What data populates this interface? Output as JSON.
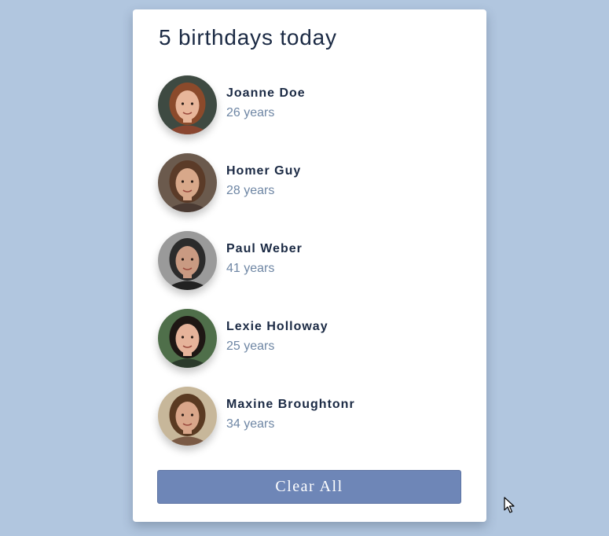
{
  "header": {
    "title": "5 birthdays today"
  },
  "people": [
    {
      "name": "Joanne Doe",
      "age": "26 years",
      "avatar_icon": "portrait-woman-red-hair",
      "colors": {
        "bg": "#3e4a42",
        "hair": "#8b4a2b",
        "skin": "#e8b69a",
        "shirt": "#8a4630"
      }
    },
    {
      "name": "Homer Guy",
      "age": "28 years",
      "avatar_icon": "portrait-young-man",
      "colors": {
        "bg": "#6b5a4d",
        "hair": "#5b3b28",
        "skin": "#d8a88a",
        "shirt": "#4a3a33"
      }
    },
    {
      "name": "Paul Weber",
      "age": "41 years",
      "avatar_icon": "portrait-man-glasses",
      "colors": {
        "bg": "#9a9a9a",
        "hair": "#2b2b2b",
        "skin": "#c99a82",
        "shirt": "#222222"
      }
    },
    {
      "name": "Lexie Holloway",
      "age": "25 years",
      "avatar_icon": "portrait-woman-dark-hair",
      "colors": {
        "bg": "#4f6f4a",
        "hair": "#1e1714",
        "skin": "#e6b39a",
        "shirt": "#2b3a2b"
      }
    },
    {
      "name": "Maxine Broughtonr",
      "age": "34 years",
      "avatar_icon": "portrait-woman-curly-hair",
      "colors": {
        "bg": "#c7b79a",
        "hair": "#5a3a22",
        "skin": "#d9a68a",
        "shirt": "#7a5a45"
      }
    }
  ],
  "actions": {
    "clear_all_label": "Clear All"
  },
  "colors": {
    "page_background": "#b1c6df",
    "card_background": "#ffffff",
    "title_text": "#1b2a44",
    "secondary_text": "#6e86a4",
    "button_background": "#6e86b7"
  }
}
